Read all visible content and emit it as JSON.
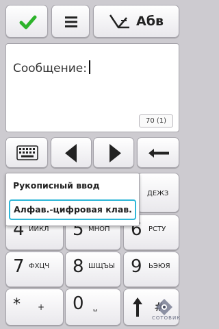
{
  "toolbar": {
    "confirm_icon": "check-icon",
    "menu_icon": "menu-icon",
    "lang_label": "Абв",
    "accent_check": "#2db32b"
  },
  "message": {
    "label": "Сообщение:",
    "counter": "70 (1)"
  },
  "nav": {
    "keyboard_icon": "keyboard-icon",
    "left_icon": "arrow-left-icon",
    "right_icon": "arrow-right-icon",
    "backspace_icon": "backspace-icon"
  },
  "popup": {
    "items": [
      "Рукописный ввод",
      "Алфав.-цифровая клав."
    ],
    "highlight_color": "#2fb7d8"
  },
  "keypad": {
    "k3": {
      "letters": "ДЕЖЗ"
    },
    "k4": {
      "digit": "4",
      "letters": "ИЙКЛ"
    },
    "k5": {
      "digit": "5",
      "letters": "МНОП"
    },
    "k6": {
      "digit": "6",
      "letters": "РСТУ"
    },
    "k7": {
      "digit": "7",
      "letters": "ФХЦЧ"
    },
    "k8": {
      "digit": "8",
      "letters": "ШЩЪЫ"
    },
    "k9": {
      "digit": "9",
      "letters": "ЬЭЮЯ"
    },
    "kstar": {
      "digit": "*",
      "letters": "+"
    },
    "k0": {
      "digit": "0",
      "letters": "␣"
    },
    "khash": {
      "digit": "#",
      "shift_icon": "shift-arrow-icon"
    }
  },
  "watermark": {
    "text": "СОТОВИК"
  }
}
